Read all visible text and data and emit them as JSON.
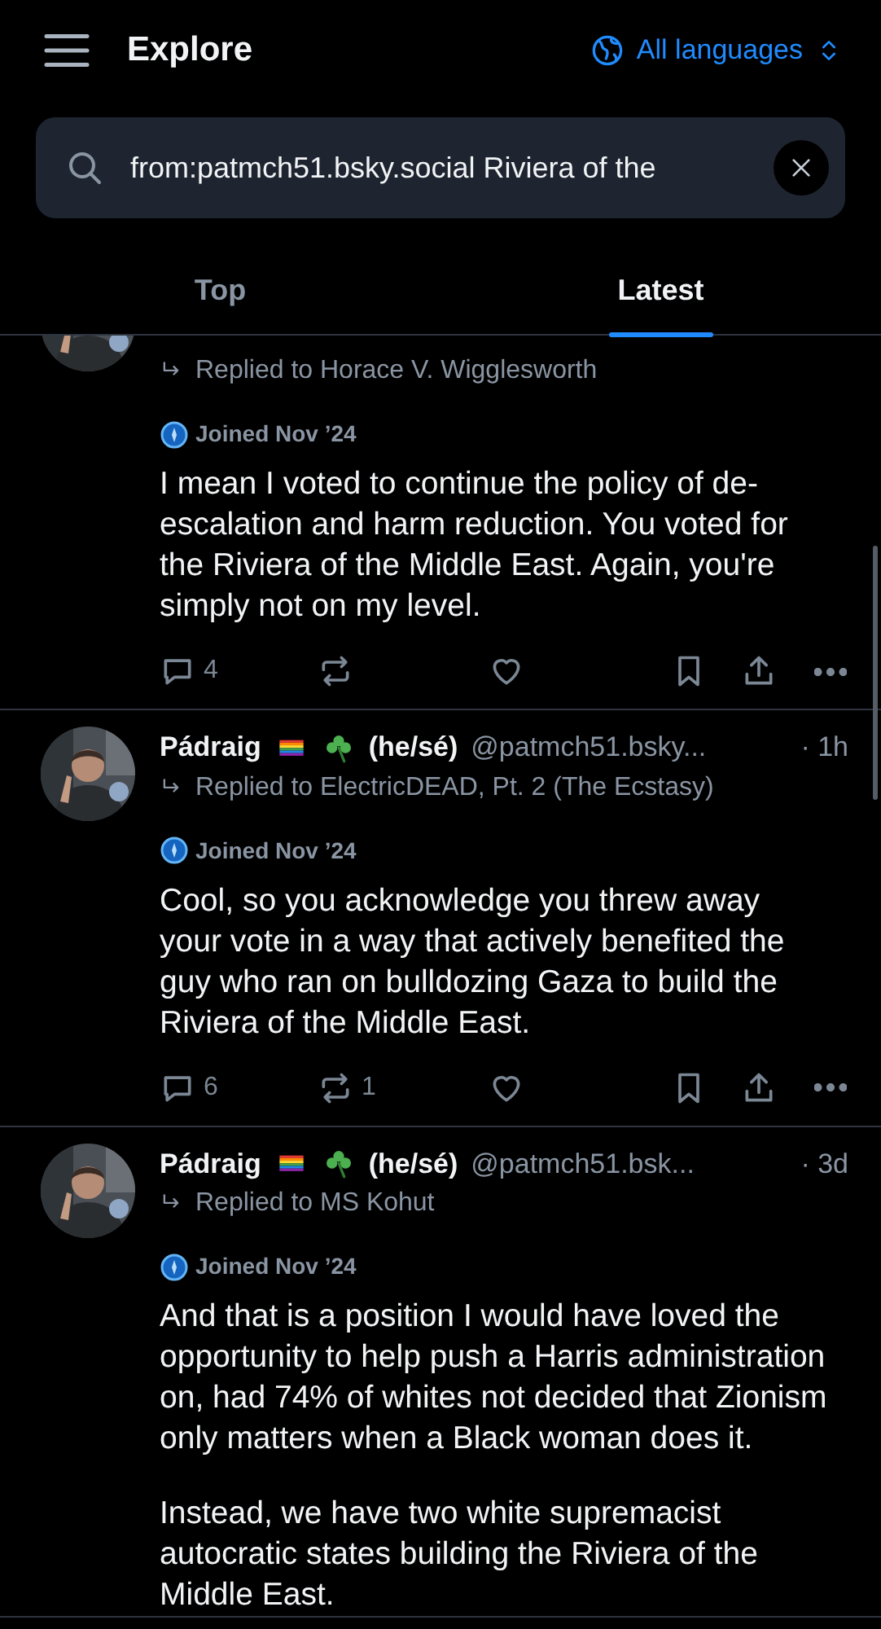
{
  "header": {
    "title": "Explore",
    "language": "All languages"
  },
  "search": {
    "value": "from:patmch51.bsky.social Riviera of the"
  },
  "tabs": [
    {
      "label": "Top",
      "selected": false
    },
    {
      "label": "Latest",
      "selected": true
    }
  ],
  "posts": [
    {
      "replied_to": "Replied to Horace V. Wigglesworth",
      "joined": "Joined Nov ’24",
      "paragraphs": [
        "I mean I voted to continue the policy of de-escalation and harm reduction. You voted for the Riviera of the Middle East. Again, you're simply not on my level."
      ],
      "actions": {
        "replies": "4"
      }
    },
    {
      "author": {
        "name": "Pádraig",
        "pronouns": "(he/sé)",
        "handle": "@patmch51.bsky...",
        "time": "· 1h"
      },
      "replied_to": "Replied to ElectricDEAD, Pt. 2 (The Ecstasy)",
      "joined": "Joined Nov ’24",
      "paragraphs": [
        "Cool, so you acknowledge you threw away your vote in a way that actively benefited the guy who ran on bulldozing Gaza to build the Riviera of the Middle East."
      ],
      "actions": {
        "replies": "6",
        "reposts": "1"
      }
    },
    {
      "author": {
        "name": "Pádraig",
        "pronouns": "(he/sé)",
        "handle": "@patmch51.bsk...",
        "time": "· 3d"
      },
      "replied_to": "Replied to MS Kohut",
      "joined": "Joined Nov ’24",
      "paragraphs": [
        "And that is a position I would have loved the opportunity to help push a Harris administration on, had 74% of whites not decided that Zionism only matters when a Black woman does it.",
        "Instead, we have two white supremacist autocratic states building the Riviera of the Middle East."
      ]
    }
  ]
}
